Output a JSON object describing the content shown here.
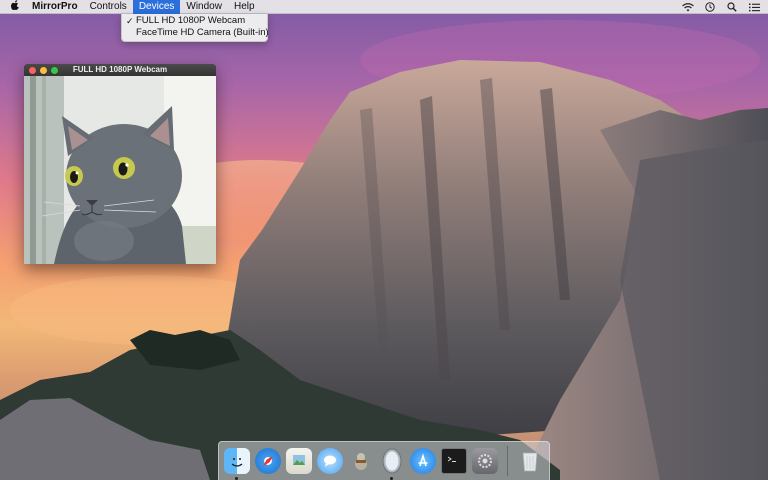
{
  "menubar": {
    "apple_icon": "apple-icon",
    "app_name": "MirrorPro",
    "menus": [
      "Controls",
      "Devices",
      "Window",
      "Help"
    ],
    "active_menu": "Devices",
    "status_icons": [
      "wifi-icon",
      "clock-icon",
      "search-icon",
      "list-icon"
    ]
  },
  "devices_menu": {
    "items": [
      {
        "label": "FULL HD 1080P Webcam",
        "checked": true
      },
      {
        "label": "FaceTime HD Camera (Built-in)",
        "checked": false
      }
    ],
    "check_glyph": "✓"
  },
  "webcam_window": {
    "title": "FULL HD 1080P Webcam"
  },
  "dock": {
    "apps": [
      {
        "name": "finder-icon",
        "running": true
      },
      {
        "name": "safari-icon",
        "running": false
      },
      {
        "name": "preview-icon",
        "running": false
      },
      {
        "name": "messages-icon",
        "running": false
      },
      {
        "name": "automator-icon",
        "running": false
      },
      {
        "name": "mirrorpro-icon",
        "running": true
      },
      {
        "name": "app-store-icon",
        "running": false
      },
      {
        "name": "terminal-icon",
        "running": false
      },
      {
        "name": "system-preferences-icon",
        "running": false
      },
      {
        "name": "trash-icon",
        "running": false
      }
    ]
  },
  "colors": {
    "menu_highlight": "#2a6fdb",
    "close": "#fc605c",
    "minimize": "#fdbc40",
    "maximize": "#34c84a"
  }
}
